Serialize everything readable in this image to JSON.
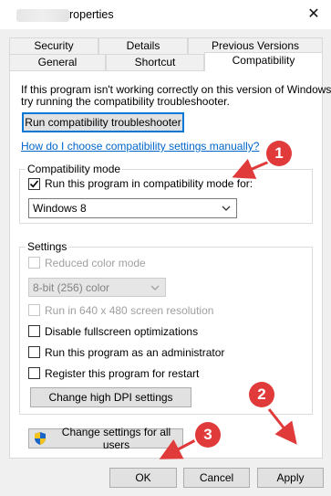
{
  "window": {
    "title_suffix": "roperties",
    "close_glyph": "✕"
  },
  "tabs_row1": [
    "Security",
    "Details",
    "Previous Versions"
  ],
  "tabs_row2": [
    "General",
    "Shortcut",
    "Compatibility"
  ],
  "intro": {
    "line1": "If this program isn't working correctly on this version of Windows,",
    "line2": "try running the compatibility troubleshooter."
  },
  "buttons": {
    "troubleshooter": "Run compatibility troubleshooter",
    "high_dpi": "Change high DPI settings",
    "all_users": "Change settings for all users",
    "ok": "OK",
    "cancel": "Cancel",
    "apply": "Apply"
  },
  "help_link": "How do I choose compatibility settings manually?",
  "compat_mode": {
    "group_label": "Compatibility mode",
    "checkbox_label": "Run this program in compatibility mode for:",
    "checked": true,
    "selected_os": "Windows 8"
  },
  "settings": {
    "group_label": "Settings",
    "reduced_color": "Reduced color mode",
    "color_depth": "8-bit (256) color",
    "resolution": "Run in 640 x 480 screen resolution",
    "fullscreen": "Disable fullscreen optimizations",
    "admin": "Run this program as an administrator",
    "register": "Register this program for restart"
  },
  "annotations": {
    "badge1": "1",
    "badge2": "2",
    "badge3": "3",
    "color": "#e03a3a"
  },
  "icons": {
    "shield": "uac-shield-icon",
    "caret": "chevron-down-icon",
    "check": "checkmark-icon"
  }
}
